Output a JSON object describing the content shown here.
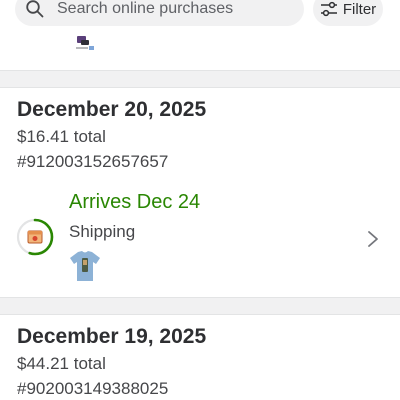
{
  "search": {
    "placeholder": "Search online purchases",
    "icon": "search-icon"
  },
  "filter": {
    "label": "Filter",
    "icon": "sliders-icon"
  },
  "orders": [
    {
      "date": "December 20, 2025",
      "total": "$16.41 total",
      "number": "#912003152657657",
      "status_title": "Arrives Dec 24",
      "status_label": "Shipping",
      "progress_fraction": 0.55
    },
    {
      "date": "December 19, 2025",
      "total": "$44.21 total",
      "number": "#902003149388025"
    }
  ],
  "colors": {
    "accent_green": "#2a8703",
    "ring_track": "#e3e4e5",
    "section_gap": "#f1f1f2"
  }
}
